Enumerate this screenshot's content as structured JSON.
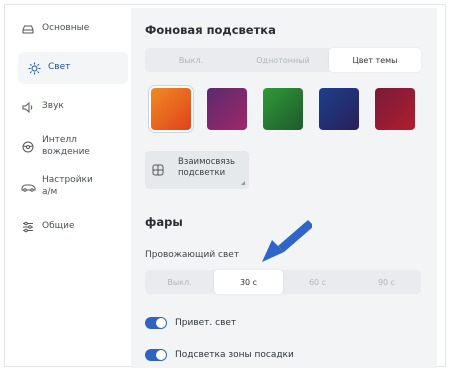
{
  "sidebar": {
    "items": [
      {
        "label": "Основные",
        "icon": "car-icon"
      },
      {
        "label": "Свет",
        "icon": "sun-icon",
        "active": true
      },
      {
        "label": "Звук",
        "icon": "speaker-icon"
      },
      {
        "label": "Интелл вождение",
        "icon": "steering-wheel-icon"
      },
      {
        "label": "Настройки а/м",
        "icon": "car-settings-icon"
      },
      {
        "label": "Общие",
        "icon": "sliders-icon"
      }
    ]
  },
  "ambient": {
    "title": "Фоновая подсветка",
    "modes": [
      "Выкл.",
      "Однотонный",
      "Цвет темы"
    ],
    "selected_mode": "Цвет темы",
    "swatches": [
      {
        "name": "orange",
        "from": "#f08a24",
        "to": "#e0421c"
      },
      {
        "name": "purple",
        "from": "#5a2a6e",
        "to": "#a0286a"
      },
      {
        "name": "green",
        "from": "#2f9a3a",
        "to": "#1f5a2a"
      },
      {
        "name": "navy",
        "from": "#1d3f8a",
        "to": "#2a1f5a"
      },
      {
        "name": "crimson",
        "from": "#7a1a3a",
        "to": "#b01e2e"
      }
    ],
    "link_button": "Взаимосвязь подсветки"
  },
  "headlights": {
    "title": "фары",
    "follow_me_label": "Провожающий свет",
    "follow_me_options": [
      "Выкл.",
      "30 с",
      "60 с",
      "90 с"
    ],
    "follow_me_selected": "30 с",
    "welcome_light": {
      "label": "Привет. свет",
      "on": true
    },
    "puddle_light": {
      "label": "Подсветка зоны посадки",
      "on": true
    }
  },
  "colors": {
    "accent": "#2f63c4",
    "arrow": "#2f64c8"
  }
}
